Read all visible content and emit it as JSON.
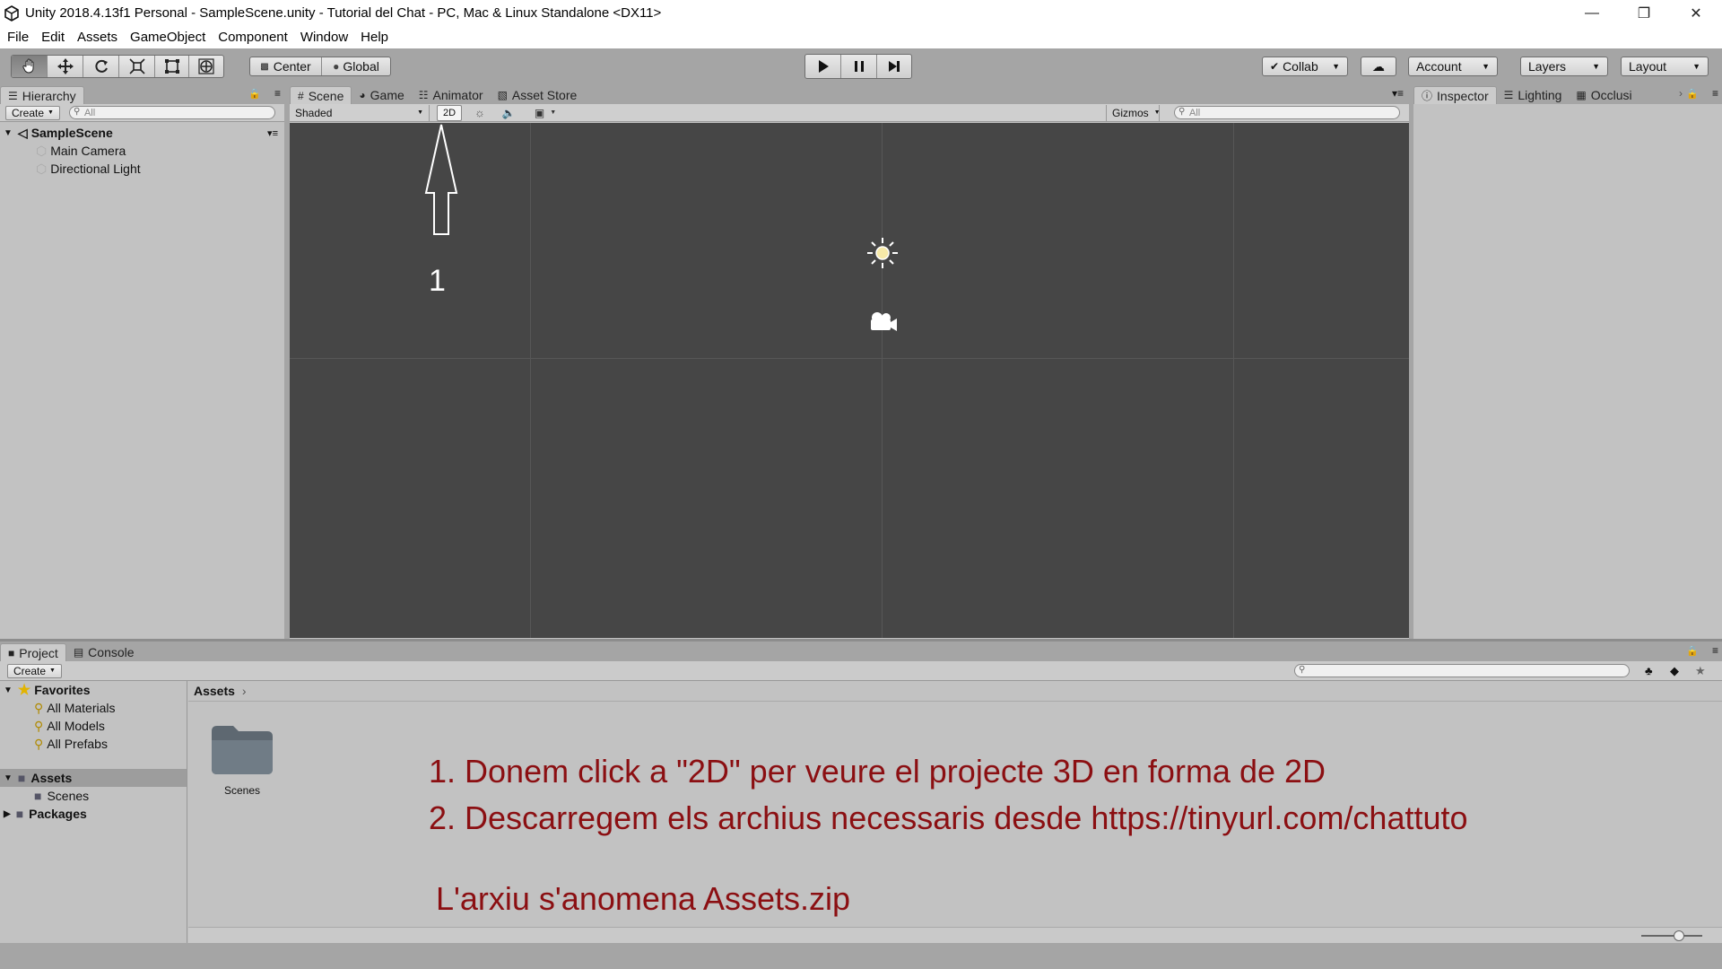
{
  "window": {
    "title": "Unity 2018.4.13f1 Personal - SampleScene.unity - Tutorial del Chat - PC, Mac & Linux Standalone <DX11>",
    "controls": [
      "minimize-icon",
      "restore-icon",
      "close-icon"
    ]
  },
  "menu": [
    "File",
    "Edit",
    "Assets",
    "GameObject",
    "Component",
    "Window",
    "Help"
  ],
  "toolbar": {
    "tools": [
      "hand-tool-icon",
      "move-tool-icon",
      "rotate-tool-icon",
      "scale-tool-icon",
      "rect-tool-icon",
      "transform-tool-icon"
    ],
    "pivot_label": "Center",
    "space_label": "Global",
    "collab_label": "Collab",
    "account_label": "Account",
    "layers_label": "Layers",
    "layout_label": "Layout"
  },
  "hierarchy": {
    "tab_label": "Hierarchy",
    "create_label": "Create",
    "search_placeholder": "All",
    "scene_name": "SampleScene",
    "items": [
      "Main Camera",
      "Directional Light"
    ]
  },
  "scene_tabs": [
    "Scene",
    "Game",
    "Animator",
    "Asset Store"
  ],
  "scene_toolbar": {
    "shading_mode": "Shaded",
    "mode_2d_label": "2D",
    "gizmos_label": "Gizmos",
    "search_placeholder": "All"
  },
  "annotation_arrow_label": "1",
  "inspector_tabs": [
    "Inspector",
    "Lighting",
    "Occlusi"
  ],
  "bottom_tabs": [
    "Project",
    "Console"
  ],
  "project": {
    "create_label": "Create",
    "favorites_label": "Favorites",
    "favorites": [
      "All Materials",
      "All Models",
      "All Prefabs"
    ],
    "assets_label": "Assets",
    "assets_children": [
      "Scenes"
    ],
    "packages_label": "Packages",
    "breadcrumb": "Assets",
    "folders": [
      "Scenes"
    ]
  },
  "instructions": {
    "line1": "1. Donem click a \"2D\" per veure el projecte 3D en forma de 2D",
    "line2": "2. Descarregem els archius necessaris desde https://tinyurl.com/chattuto",
    "line3": "L'arxiu s'anomena Assets.zip",
    "color": "#8b0f12"
  },
  "colors": {
    "scene_bg": "#464646",
    "panel_bg": "#c2c2c2",
    "toolbar_bg": "#a5a5a5"
  }
}
